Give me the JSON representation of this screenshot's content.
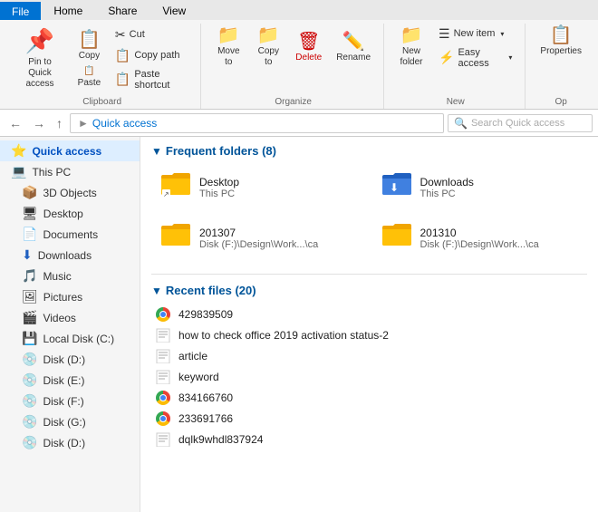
{
  "tabs": [
    {
      "label": "File",
      "active": true,
      "color": "#0072d2"
    },
    {
      "label": "Home",
      "active": false
    },
    {
      "label": "Share",
      "active": false
    },
    {
      "label": "View",
      "active": false
    }
  ],
  "toolbar": {
    "groups": [
      {
        "id": "pin",
        "label": "Clipboard",
        "buttons": [
          {
            "id": "pin",
            "icon": "📌",
            "label": "Pin to Quick\naccess",
            "large": true
          },
          {
            "id": "copy",
            "icon": "📋",
            "label": "Copy"
          },
          {
            "id": "paste",
            "icon": "📋",
            "label": "Paste"
          }
        ],
        "small_buttons": [
          {
            "id": "cut",
            "icon": "✂",
            "label": "Cut"
          },
          {
            "id": "copy-path",
            "icon": "📋",
            "label": "Copy path"
          },
          {
            "id": "paste-shortcut",
            "icon": "📋",
            "label": "Paste shortcut"
          }
        ]
      },
      {
        "id": "organize",
        "label": "Organize",
        "buttons": [
          {
            "id": "move-to",
            "icon": "📁",
            "label": "Move\nto"
          },
          {
            "id": "copy-to",
            "icon": "📁",
            "label": "Copy\nto"
          },
          {
            "id": "delete",
            "icon": "🗑",
            "label": "Delete",
            "delete": true
          },
          {
            "id": "rename",
            "icon": "✏",
            "label": "Rename"
          }
        ]
      },
      {
        "id": "new",
        "label": "New",
        "buttons": [
          {
            "id": "new-folder",
            "icon": "📁",
            "label": "New\nfolder"
          }
        ],
        "small_buttons": [
          {
            "id": "new-item",
            "icon": "☰",
            "label": "New item"
          },
          {
            "id": "easy-access",
            "icon": "⚡",
            "label": "Easy access"
          }
        ]
      },
      {
        "id": "open",
        "label": "Op",
        "buttons": [
          {
            "id": "properties",
            "icon": "🔍",
            "label": "Properties"
          }
        ]
      }
    ]
  },
  "address": {
    "path": "Quick access",
    "breadcrumb": "Quick access"
  },
  "sidebar": {
    "items": [
      {
        "id": "quick-access",
        "icon": "⭐",
        "label": "Quick access",
        "active": true,
        "highlighted": true
      },
      {
        "id": "this-pc",
        "icon": "💻",
        "label": "This PC"
      },
      {
        "id": "3d-objects",
        "icon": "📦",
        "label": "3D Objects"
      },
      {
        "id": "desktop",
        "icon": "🖥",
        "label": "Desktop"
      },
      {
        "id": "documents",
        "icon": "📄",
        "label": "Documents"
      },
      {
        "id": "downloads",
        "icon": "⬇",
        "label": "Downloads"
      },
      {
        "id": "music",
        "icon": "🎵",
        "label": "Music"
      },
      {
        "id": "pictures",
        "icon": "🖼",
        "label": "Pictures"
      },
      {
        "id": "videos",
        "icon": "🎬",
        "label": "Videos"
      },
      {
        "id": "local-disk-c",
        "icon": "💾",
        "label": "Local Disk (C:)"
      },
      {
        "id": "disk-d",
        "icon": "💿",
        "label": "Disk (D:)"
      },
      {
        "id": "disk-e",
        "icon": "💿",
        "label": "Disk (E:)"
      },
      {
        "id": "disk-f",
        "icon": "💿",
        "label": "Disk (F:)"
      },
      {
        "id": "disk-g",
        "icon": "💿",
        "label": "Disk (G:)"
      },
      {
        "id": "disk-d2",
        "icon": "💿",
        "label": "Disk (D:)"
      }
    ]
  },
  "content": {
    "frequent_folders": {
      "header": "Frequent folders",
      "count": 8,
      "items": [
        {
          "id": "desktop",
          "name": "Desktop",
          "sub": "This PC",
          "icon": "folder-desktop"
        },
        {
          "id": "downloads",
          "name": "Downloads",
          "sub": "This PC",
          "icon": "folder-downloads"
        },
        {
          "id": "201307",
          "name": "201307",
          "sub": "Disk (F:)\\Design\\Work...\\ca",
          "icon": "folder-plain"
        },
        {
          "id": "201310",
          "name": "201310",
          "sub": "Disk (F:)\\Design\\Work...\\ca",
          "icon": "folder-plain"
        }
      ]
    },
    "recent_files": {
      "header": "Recent files",
      "count": 20,
      "items": [
        {
          "id": "1",
          "name": "429839509",
          "type": "chrome"
        },
        {
          "id": "2",
          "name": "how to check office 2019 activation status-2",
          "type": "doc"
        },
        {
          "id": "3",
          "name": "article",
          "type": "doc"
        },
        {
          "id": "4",
          "name": "keyword",
          "type": "doc"
        },
        {
          "id": "5",
          "name": "834166760",
          "type": "chrome"
        },
        {
          "id": "6",
          "name": "233691766",
          "type": "chrome"
        },
        {
          "id": "7",
          "name": "dqlk9whdl837924",
          "type": "doc"
        },
        {
          "id": "8",
          "name": "...",
          "type": "doc"
        }
      ]
    }
  }
}
